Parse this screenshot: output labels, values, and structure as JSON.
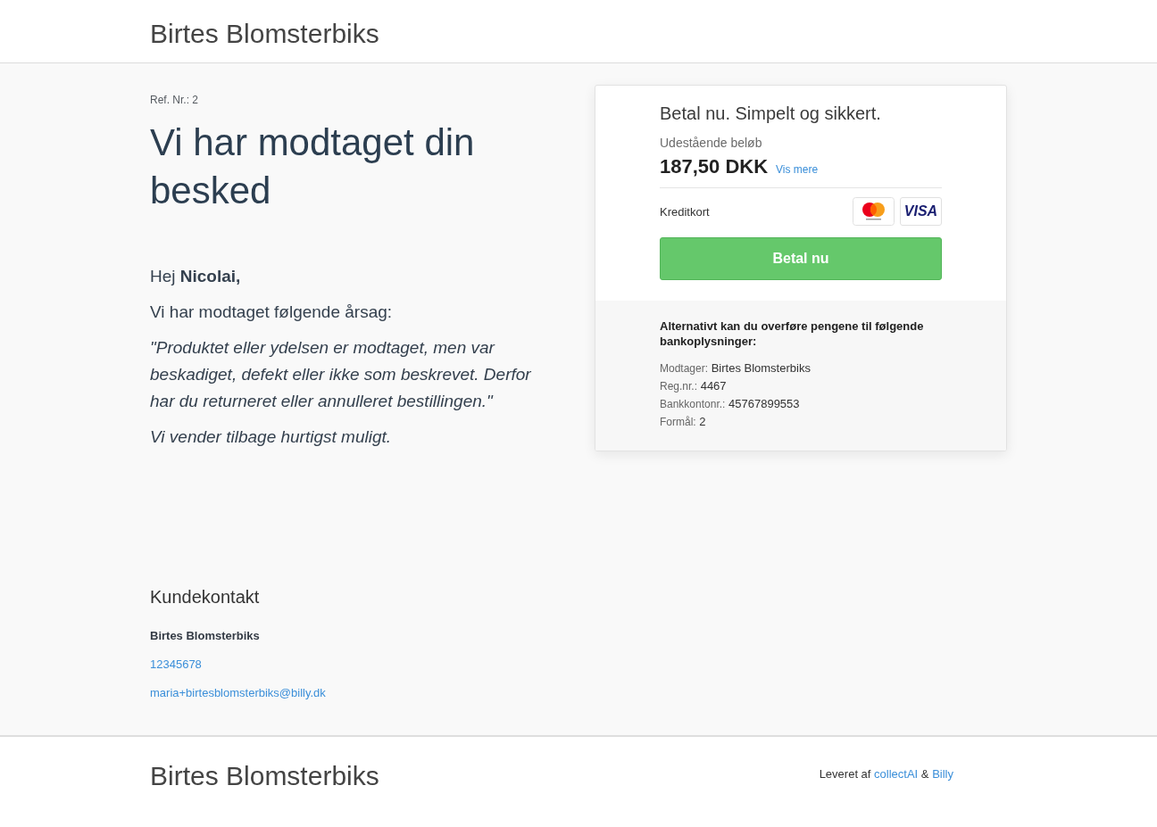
{
  "header": {
    "title": "Birtes Blomsterbiks"
  },
  "message": {
    "reference": "Ref. Nr.: 2",
    "heading": "Vi har modtaget din besked",
    "greeting": "Hej **Nicolai,**",
    "intro": "Vi har modtaget følgende årsag:",
    "reason": "\"Produktet eller ydelsen er modtaget, men var beskadiget, defekt eller ikke som beskrevet. Derfor har du returneret eller annulleret bestillingen.\"",
    "closing": "Vi vender tilbage hurtigst muligt."
  },
  "payment": {
    "title": "Betal nu. Simpelt og sikkert.",
    "amount_label": "Udestående beløb",
    "amount": "187,50 DKK",
    "details_link": "Vis mere",
    "method": "Kreditkort",
    "card_logos": [
      {
        "kind": "mastercard"
      },
      {
        "kind": "visa",
        "label": "VISA"
      }
    ],
    "pay_button": "Betal nu"
  },
  "bank_transfer": {
    "intro": "Alternativt kan du overføre pengene til følgende bankoplysninger:",
    "fields": [
      {
        "label": "Modtager:",
        "value": "Birtes Blomsterbiks"
      },
      {
        "label": "Reg.nr.:",
        "value": "4467"
      },
      {
        "label": "Bankkontonr.:",
        "value": "45767899553"
      },
      {
        "label": "Formål:",
        "value": "2"
      }
    ]
  },
  "contact": {
    "heading": "Kundekontakt",
    "name": "Birtes Blomsterbiks",
    "phone": "12345678",
    "email": "maria+birtesblomsterbiks@billy.dk"
  },
  "footer": {
    "title": "Birtes Blomsterbiks",
    "credit": "Leveret af",
    "links": [
      "collectAI",
      "Billy"
    ],
    "separator": "&"
  }
}
